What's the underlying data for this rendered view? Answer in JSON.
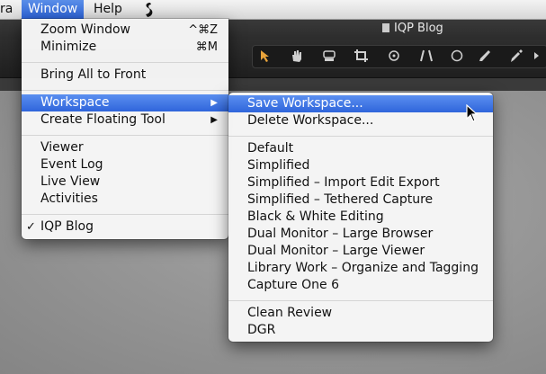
{
  "menubar": {
    "items": [
      {
        "label": "ra"
      },
      {
        "label": "Window"
      },
      {
        "label": "Help"
      }
    ],
    "script_icon": "script-menu-icon"
  },
  "window_title": "IQP Blog",
  "window_menu": {
    "zoom": {
      "label": "Zoom Window",
      "shortcut": "^⌘Z"
    },
    "minimize": {
      "label": "Minimize",
      "shortcut": "⌘M"
    },
    "bring_all": {
      "label": "Bring All to Front"
    },
    "workspace": {
      "label": "Workspace"
    },
    "floating_tool": {
      "label": "Create Floating Tool"
    },
    "viewer": {
      "label": "Viewer"
    },
    "event_log": {
      "label": "Event Log"
    },
    "live_view": {
      "label": "Live View"
    },
    "activities": {
      "label": "Activities"
    },
    "iqp_blog": {
      "label": "IQP Blog",
      "checked": "✓"
    }
  },
  "workspace_menu": {
    "save": "Save Workspace...",
    "delete": "Delete Workspace...",
    "presets": [
      "Default",
      "Simplified",
      "Simplified – Import Edit Export",
      "Simplified – Tethered Capture",
      "Black & White Editing",
      "Dual Monitor – Large Browser",
      "Dual Monitor – Large Viewer",
      "Library Work – Organize and Tagging",
      "Capture One 6"
    ],
    "custom": [
      "Clean Review",
      "DGR"
    ]
  },
  "colors": {
    "highlight": "#3a6fe0",
    "menu_bg": "#f6f6f6",
    "toolbar_bg": "#262626"
  }
}
